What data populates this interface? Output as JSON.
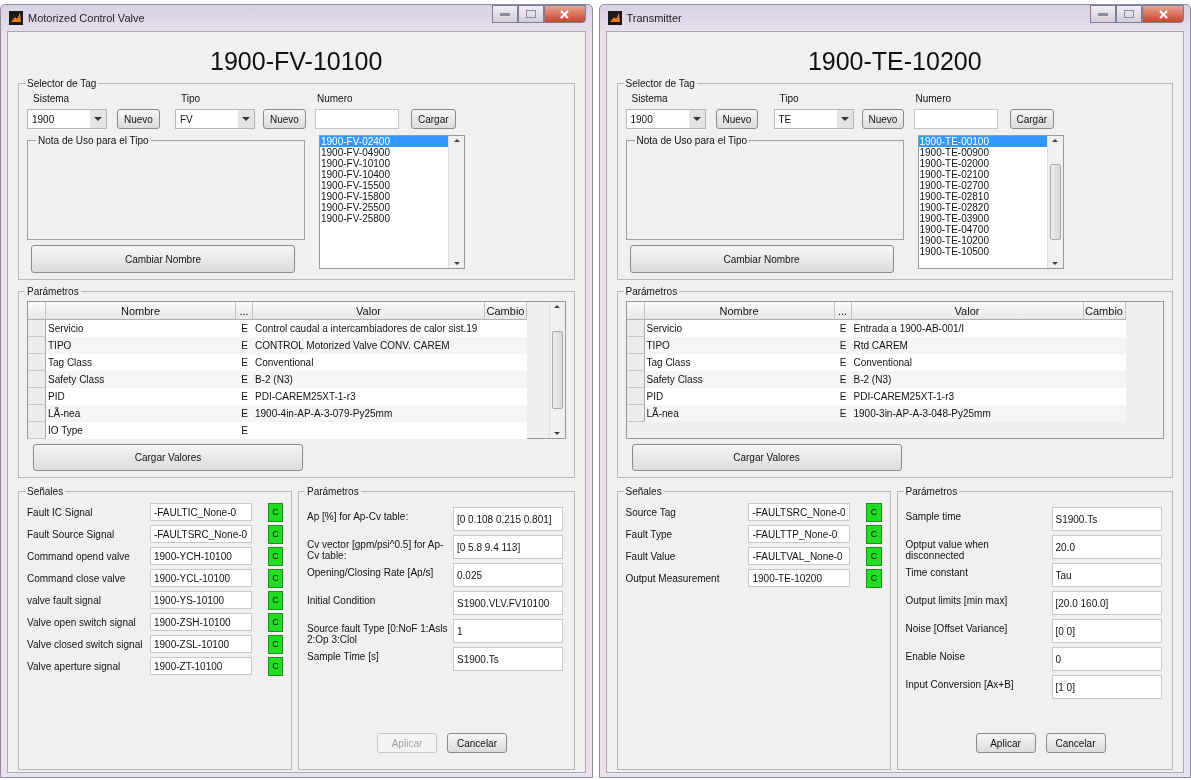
{
  "windows": [
    {
      "title": "Motorized Control Valve",
      "tag": "1900-FV-10100",
      "selector": {
        "title": "Selector de Tag",
        "sistema": {
          "label": "Sistema",
          "value": "1900",
          "new_button": "Nuevo"
        },
        "tipo": {
          "label": "Tipo",
          "value": "FV",
          "new_button": "Nuevo"
        },
        "numero": {
          "label": "Numero",
          "load_button": "Cargar"
        },
        "note_title": "Nota de Uso para el Tipo",
        "rename_button": "Cambiar Nombre",
        "tag_list": [
          {
            "label": "1900-FV-02400",
            "selected": true
          },
          {
            "label": "1900-FV-04900",
            "selected": false
          },
          {
            "label": "1900-FV-10100",
            "selected": false
          },
          {
            "label": "1900-FV-10400",
            "selected": false
          },
          {
            "label": "1900-FV-15500",
            "selected": false
          },
          {
            "label": "1900-FV-15800",
            "selected": false
          },
          {
            "label": "1900-FV-25500",
            "selected": false
          },
          {
            "label": "1900-FV-25800",
            "selected": false
          }
        ]
      },
      "parameters": {
        "title": "Parámetros",
        "columns": [
          "Nombre",
          "...",
          "Valor",
          "Cambio"
        ],
        "rows": [
          {
            "name": "Servicio",
            "flag": "E",
            "value": "Control caudal a intercambiadores de calor sist.19"
          },
          {
            "name": "TIPO",
            "flag": "E",
            "value": "CONTROL Motorized Valve CONV. CAREM"
          },
          {
            "name": "Tag Class",
            "flag": "E",
            "value": "Conventional"
          },
          {
            "name": "Safety Class",
            "flag": "E",
            "value": "B-2 (N3)"
          },
          {
            "name": "PID",
            "flag": "E",
            "value": "PDI-CAREM25XT-1-r3"
          },
          {
            "name": "LÃ-nea",
            "flag": "E",
            "value": "1900-4in-AP-A-3-079-Py25mm"
          },
          {
            "name": "IO Type",
            "flag": "E"
          }
        ],
        "load_button": "Cargar Valores"
      },
      "signals": {
        "title": "Señales",
        "rows": [
          {
            "label": "Fault IC Signal",
            "value": "-FAULTIC_None-0",
            "button": "C"
          },
          {
            "label": "Fault Source Signal",
            "value": "-FAULTSRC_None-0",
            "button": "C"
          },
          {
            "label": "Command opend valve",
            "value": "1900-YCH-10100",
            "button": "C"
          },
          {
            "label": "Command close valve",
            "value": "1900-YCL-10100",
            "button": "C"
          },
          {
            "label": "valve fault signal",
            "value": "1900-YS-10100",
            "button": "C"
          },
          {
            "label": "Valve open switch signal",
            "value": "1900-ZSH-10100",
            "button": "C"
          },
          {
            "label": "Valve closed switch signal",
            "value": "1900-ZSL-10100",
            "button": "C"
          },
          {
            "label": "Valve aperture signal",
            "value": "1900-ZT-10100",
            "button": "C"
          }
        ]
      },
      "settings": {
        "title": "Parámetros",
        "rows": [
          {
            "label": "Ap [%] for Ap-Cv table:",
            "value": "[0 0.108 0.215 0.801]"
          },
          {
            "label": " Cv vector [gpm/psi^0.5] for Ap-Cv table:",
            "value": "[0 5.8 9.4 113]"
          },
          {
            "label": "Opening/Closing Rate  [Ap/s]",
            "value": "0.025"
          },
          {
            "label": "Initial Condition",
            "value": "S1900.VLV.FV10100"
          },
          {
            "label": "Source fault Type [0:NoF 1:Asls 2:Op 3:Clol",
            "value": "1"
          },
          {
            "label": "Sample Time  [s]",
            "value": "S1900.Ts"
          }
        ],
        "buttons": [
          {
            "label": "Aplicar",
            "disabled": true
          },
          {
            "label": "Cancelar",
            "disabled": false
          }
        ]
      }
    },
    {
      "title": "Transmitter",
      "tag": "1900-TE-10200",
      "selector": {
        "title": "Selector de Tag",
        "sistema": {
          "label": "Sistema",
          "value": "1900",
          "new_button": "Nuevo"
        },
        "tipo": {
          "label": "Tipo",
          "value": "TE",
          "new_button": "Nuevo"
        },
        "numero": {
          "label": "Numero",
          "load_button": "Cargar"
        },
        "note_title": "Nota de Uso para el Tipo",
        "rename_button": "Cambiar Nombre",
        "tag_list": [
          {
            "label": "1900-TE-00100",
            "selected": true
          },
          {
            "label": "1900-TE-00900",
            "selected": false
          },
          {
            "label": "1900-TE-02000",
            "selected": false
          },
          {
            "label": "1900-TE-02100",
            "selected": false
          },
          {
            "label": "1900-TE-02700",
            "selected": false
          },
          {
            "label": "1900-TE-02810",
            "selected": false
          },
          {
            "label": "1900-TE-02820",
            "selected": false
          },
          {
            "label": "1900-TE-03900",
            "selected": false
          },
          {
            "label": "1900-TE-04700",
            "selected": false
          },
          {
            "label": "1900-TE-10200",
            "selected": false
          },
          {
            "label": "1900-TE-10500",
            "selected": false
          }
        ]
      },
      "parameters": {
        "title": "Parámetros",
        "columns": [
          "Nombre",
          "...",
          "Valor",
          "Cambio"
        ],
        "rows": [
          {
            "name": "Servicio",
            "flag": "E",
            "value": "Entrada a 1900-AB-001/I"
          },
          {
            "name": "TIPO",
            "flag": "E",
            "value": "Rtd CAREM"
          },
          {
            "name": "Tag Class",
            "flag": "E",
            "value": "Conventional"
          },
          {
            "name": "Safety Class",
            "flag": "E",
            "value": "B-2 (N3)"
          },
          {
            "name": "PID",
            "flag": "E",
            "value": "PDI-CAREM25XT-1-r3"
          },
          {
            "name": "LÃ-nea",
            "flag": "E",
            "value": "1900-3in-AP-A-3-048-Py25mm"
          }
        ],
        "load_button": "Cargar Valores"
      },
      "signals": {
        "title": "Señales",
        "rows": [
          {
            "label": "Source Tag",
            "value": "-FAULTSRC_None-0",
            "button": "C"
          },
          {
            "label": "Fault Type",
            "value": "-FAULTTP_None-0",
            "button": "C"
          },
          {
            "label": "Fault Value",
            "value": "-FAULTVAL_None-0",
            "button": "C"
          },
          {
            "label": "Output Measurement",
            "value": "1900-TE-10200",
            "button": "C"
          }
        ]
      },
      "settings": {
        "title": "Parámetros",
        "rows": [
          {
            "label": "Sample time",
            "value": "S1900.Ts"
          },
          {
            "label": "Optput value when disconnected",
            "value": "20.0"
          },
          {
            "label": "Time constant",
            "value": "Tau"
          },
          {
            "label": "Output limits [min max]",
            "value": "[20.0 160.0]"
          },
          {
            "label": "Noise [Offset Variance]",
            "value": "[0 0]"
          },
          {
            "label": "Enable Noise",
            "value": "0"
          },
          {
            "label": "Input Conversion [Ax+B]",
            "value": "[1 0]"
          }
        ],
        "buttons": [
          {
            "label": "Aplicar",
            "disabled": false
          },
          {
            "label": "Cancelar",
            "disabled": false
          }
        ]
      }
    }
  ]
}
